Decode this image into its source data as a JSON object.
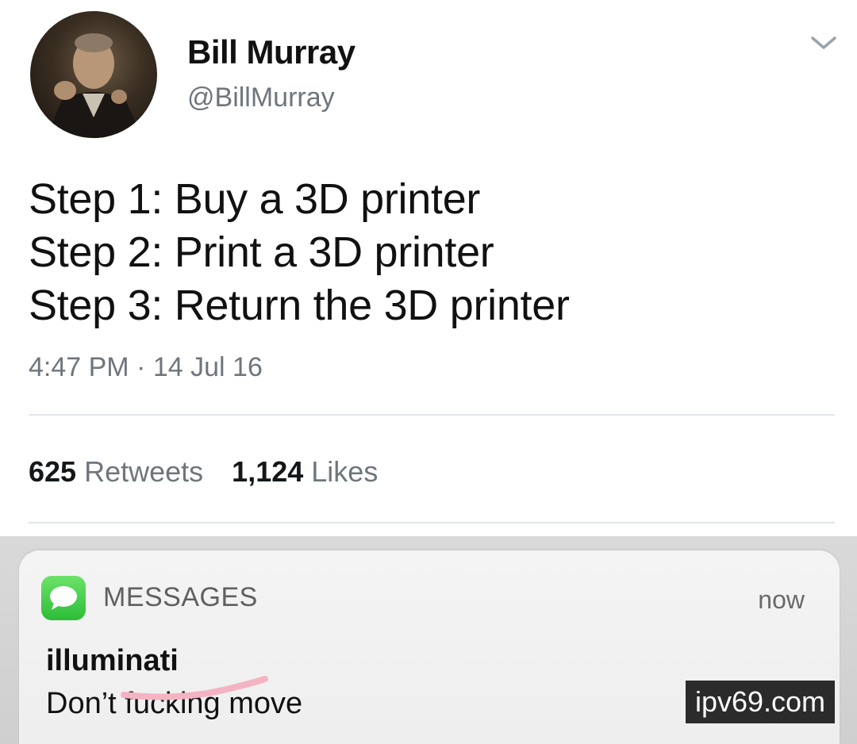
{
  "tweet": {
    "author": {
      "name": "Bill Murray",
      "handle": "@BillMurray"
    },
    "menu_icon": "chevron-down-icon",
    "lines": [
      "Step 1: Buy a 3D printer",
      "Step 2: Print a 3D printer",
      "Step 3: Return the 3D printer"
    ],
    "time": "4:47 PM",
    "separator": "·",
    "date": "14 Jul 16",
    "stats": {
      "retweets_count": "625",
      "retweets_label": "Retweets",
      "likes_count": "1,124",
      "likes_label": "Likes"
    }
  },
  "notification": {
    "app_icon": "messages-icon",
    "app_name": "MESSAGES",
    "time": "now",
    "sender": "illuminati",
    "message_start": "Don’t ",
    "message_censored": "fucking",
    "message_end": " move"
  },
  "watermark": {
    "text": "ipv69.com"
  },
  "colors": {
    "muted_text": "#6e767d",
    "divider": "#e3e6e8",
    "messages_green": "#2cbd38",
    "censor_pink": "#f4b3c2"
  }
}
